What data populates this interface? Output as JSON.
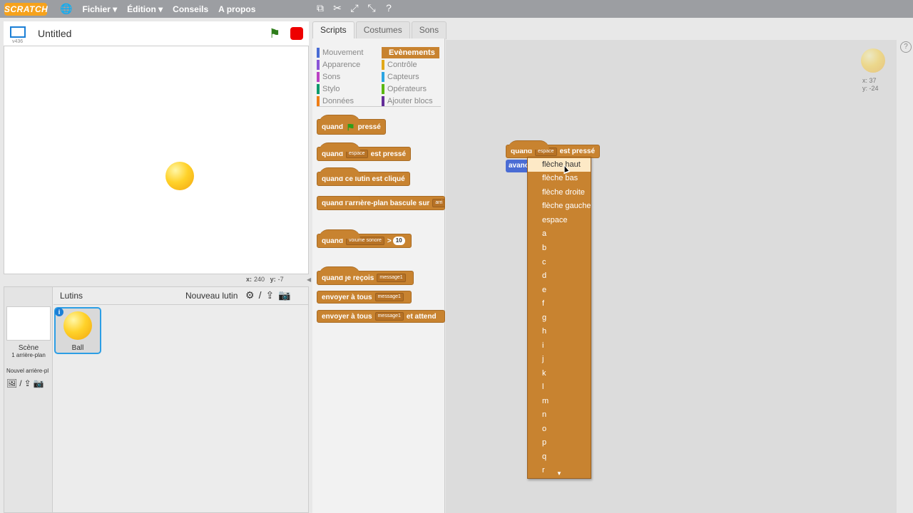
{
  "menu": {
    "logo": "SCRATCH",
    "items": [
      "Fichier ▾",
      "Édition ▾",
      "Conseils",
      "A propos"
    ],
    "tool_icons": [
      "copy-stamp-icon",
      "cut-icon",
      "grow-icon",
      "shrink-icon",
      "help-icon"
    ]
  },
  "stage": {
    "title": "Untitled",
    "version": "v436",
    "coords": {
      "x_label": "x:",
      "x": "240",
      "y_label": "y:",
      "y": "-7"
    }
  },
  "sprites": {
    "title": "Lutins",
    "new_sprite": "Nouveau lutin",
    "scene_label": "Scène",
    "scene_sub": "1 arrière-plan",
    "new_bg": "Nouvel arrière-pl",
    "list": [
      {
        "name": "Ball"
      }
    ]
  },
  "tabs": [
    "Scripts",
    "Costumes",
    "Sons"
  ],
  "categories": {
    "left": [
      {
        "label": "Mouvement",
        "color": "#4a6cd4"
      },
      {
        "label": "Apparence",
        "color": "#8a55d7"
      },
      {
        "label": "Sons",
        "color": "#bb42c3"
      },
      {
        "label": "Stylo",
        "color": "#0e9a6c"
      },
      {
        "label": "Données",
        "color": "#ee7d16"
      }
    ],
    "right": [
      {
        "label": "Evènements",
        "color": "#c88330"
      },
      {
        "label": "Contrôle",
        "color": "#e1a91a"
      },
      {
        "label": "Capteurs",
        "color": "#2ca5e2"
      },
      {
        "label": "Opérateurs",
        "color": "#5cb712"
      },
      {
        "label": "Ajouter blocs",
        "color": "#632d99"
      }
    ]
  },
  "palette_blocks": {
    "b1_a": "quand",
    "b1_b": "pressé",
    "b2_a": "quand",
    "b2_drop": "espace",
    "b2_b": "est pressé",
    "b3": "quand ce lutin est cliqué",
    "b4_a": "quand l'arrière-plan bascule sur",
    "b4_drop": "arri",
    "b5_a": "quand",
    "b5_drop": "volume sonore",
    "b5_op": ">",
    "b5_num": "10",
    "b6_a": "quand je reçois",
    "b6_drop": "message1",
    "b7_a": "envoyer à tous",
    "b7_drop": "message1",
    "b8_a": "envoyer à tous",
    "b8_drop": "message1",
    "b8_b": "et attend"
  },
  "script": {
    "hat_a": "quand",
    "hat_drop": "espace",
    "hat_b": "est pressé",
    "motion": "avanc",
    "ghost_x": "x: 37",
    "ghost_y": "y: -24"
  },
  "dropdown": {
    "items": [
      "flèche haut",
      "flèche bas",
      "flèche droite",
      "flèche gauche",
      "espace",
      "a",
      "b",
      "c",
      "d",
      "e",
      "f",
      "g",
      "h",
      "i",
      "j",
      "k",
      "l",
      "m",
      "n",
      "o",
      "p",
      "q",
      "r"
    ],
    "hovered": "flèche haut"
  }
}
